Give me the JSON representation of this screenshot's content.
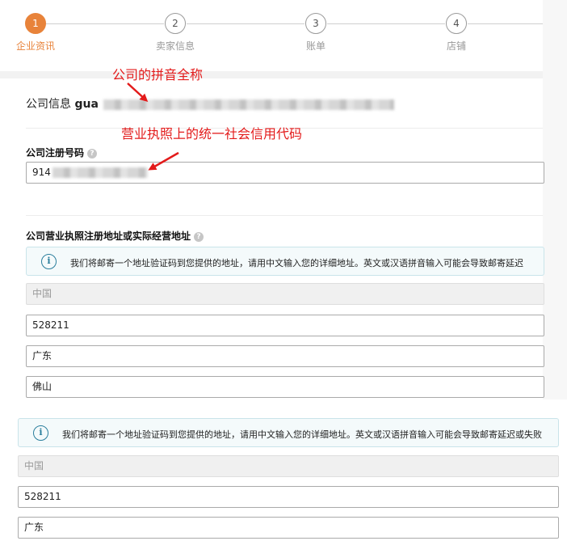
{
  "stepper": {
    "steps": [
      {
        "number": "1",
        "label": "企业资讯"
      },
      {
        "number": "2",
        "label": "卖家信息"
      },
      {
        "number": "3",
        "label": "账单"
      },
      {
        "number": "4",
        "label": "店铺"
      }
    ],
    "accent_color": "#e8833a"
  },
  "company": {
    "label": "公司信息",
    "name_prefix": "gua"
  },
  "registration": {
    "label": "公司注册号码",
    "value": "914"
  },
  "address": {
    "label": "公司营业执照注册地址或实际经营地址",
    "notice": "我们将邮寄一个地址验证码到您提供的地址，请用中文输入您的详细地址。英文或汉语拼音输入可能会导致邮寄延迟",
    "country": "中国",
    "postal_code": "528211",
    "province": "广东",
    "city": "佛山"
  },
  "lower_section": {
    "notice": "我们将邮寄一个地址验证码到您提供的地址，请用中文输入您的详细地址。英文或汉语拼音输入可能会导致邮寄延迟或失败",
    "country": "中国",
    "postal_code": "528211",
    "province": "广东"
  },
  "annotations": {
    "company_name_note": "公司的拼音全称",
    "credit_code_note": "营业执照上的统一社会信用代码",
    "color": "#e31b1b"
  },
  "icons": {
    "help": "?",
    "info": "i"
  }
}
